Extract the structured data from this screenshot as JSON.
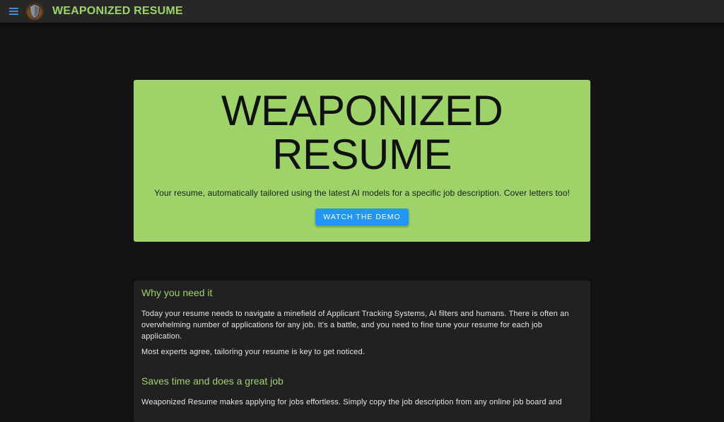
{
  "appbar": {
    "brand": "WEAPONIZED RESUME"
  },
  "hero": {
    "title_line1": "WEAPONIZED",
    "title_line2": "RESUME",
    "subtitle": "Your resume, automatically tailored using the latest AI models for a specific job description. Cover letters too!",
    "cta_label": "WATCH THE DEMO"
  },
  "sections": {
    "why": {
      "heading": "Why you need it",
      "p1": "Today your resume needs to navigate a minefield of Applicant Tracking Systems, AI filters and humans. There is often an overwhelming number of applications for any job. It's a battle, and you need to fine tune your resume for each job application.",
      "p2": "Most experts agree, tailoring your resume is key to get noticed."
    },
    "saves": {
      "heading": "Saves time and does a great job",
      "p1": "Weaponized Resume makes applying for jobs effortless. Simply copy the job description from any online job board and"
    }
  },
  "colors": {
    "accent": "#9ed36a",
    "button": "#2196f3",
    "background": "#121212",
    "appbar": "#272727",
    "card": "#212121"
  },
  "icons": {
    "menu": "hamburger-menu-icon",
    "logo": "shield-logo-icon"
  }
}
